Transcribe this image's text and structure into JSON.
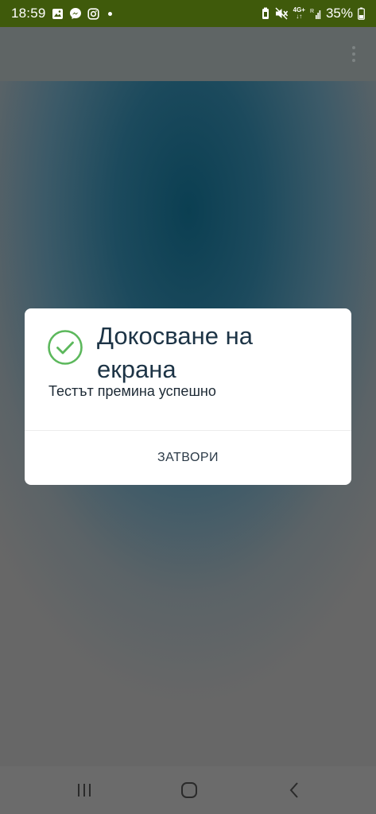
{
  "status_bar": {
    "time": "18:59",
    "battery": "35%",
    "icons_left": [
      "gallery-icon",
      "messenger-icon",
      "instagram-icon",
      "dot-icon"
    ],
    "icons_right": [
      "battery-saver-icon",
      "mute-icon",
      "4g-network-icon",
      "signal-icon",
      "battery-icon"
    ],
    "network_label_top": "4G+",
    "network_label_bottom": "↓↑"
  },
  "dialog": {
    "title": "Докосване на екрана",
    "message": "Тестът премина успешно",
    "close_label": "ЗАТВОРИ",
    "status_color": "#5cb85c"
  },
  "nav_bar": {
    "buttons": [
      "recent-apps",
      "home",
      "back"
    ]
  }
}
